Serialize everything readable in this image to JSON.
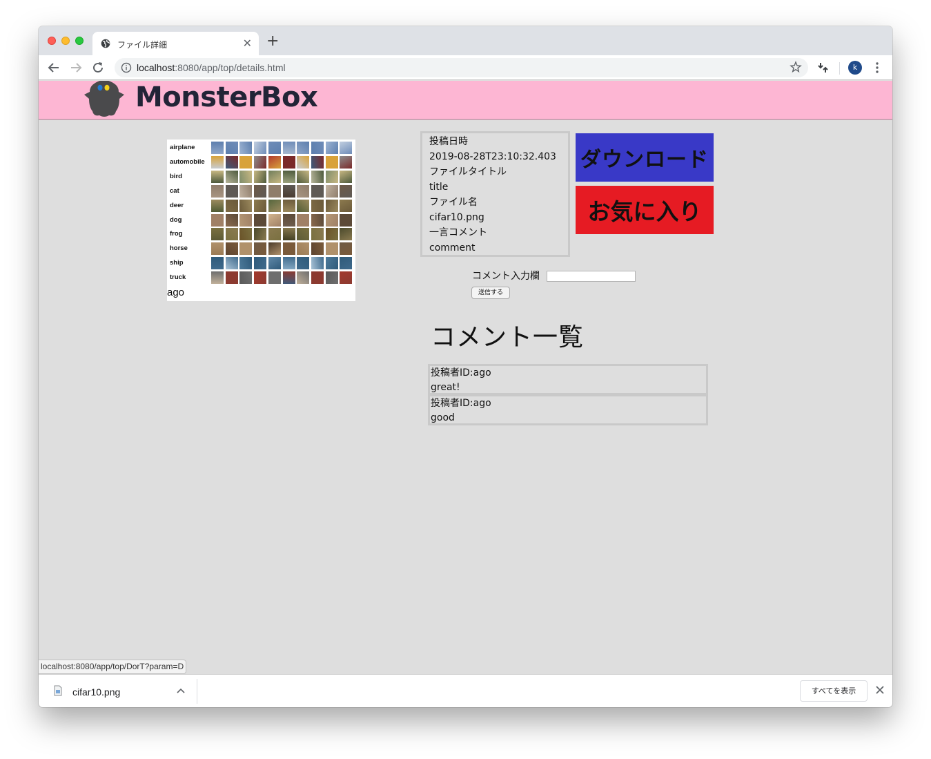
{
  "browser": {
    "tab_title": "ファイル詳細",
    "url_host": "localhost",
    "url_rest": ":8080/app/top/details.html",
    "avatar_letter": "k"
  },
  "site": {
    "brand": "MonsterBox",
    "header_color": "#fdb6d3"
  },
  "preview": {
    "classes": [
      "airplane",
      "automobile",
      "bird",
      "cat",
      "deer",
      "dog",
      "frog",
      "horse",
      "ship",
      "truck"
    ],
    "owner": "ago"
  },
  "details": {
    "lines": [
      "投稿日時",
      "2019-08-28T23:10:32.403",
      "ファイルタイトル",
      "title",
      "ファイル名",
      "cifar10.png",
      "一言コメント",
      "comment"
    ]
  },
  "actions": {
    "download_label": "ダウンロード",
    "download_color": "#3939c7",
    "favorite_label": "お気に入り",
    "favorite_color": "#e61b23"
  },
  "comment_form": {
    "label": "コメント入力欄",
    "value": "",
    "submit_label": "送信する"
  },
  "comment_list": {
    "title": "コメント一覧",
    "items": [
      {
        "author": "投稿者ID:ago",
        "text": "great!"
      },
      {
        "author": "投稿者ID:ago",
        "text": "good"
      }
    ]
  },
  "status_url": "localhost:8080/app/top/DorT?param=D",
  "download_bar": {
    "file_name": "cifar10.png",
    "show_all": "すべてを表示"
  }
}
